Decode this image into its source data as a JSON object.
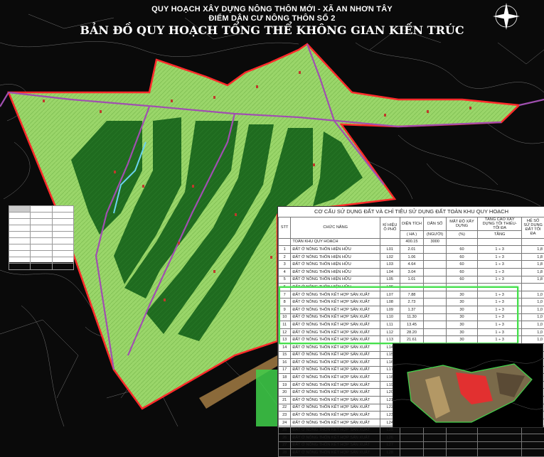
{
  "header": {
    "line1": "QUY HOẠCH XÂY DỰNG NÔNG THÔN MỚI - XÃ AN NHƠN TÂY",
    "line2": "ĐIỂM DÂN CƯ NÔNG THÔN SỐ 2",
    "title": "BẢN ĐỒ QUY HOẠCH TỔNG THỂ KHÔNG GIAN KIẾN TRÚC"
  },
  "colors": {
    "background": "#0a0a0a",
    "light_green": "#9ad66a",
    "dark_green": "#1f6b1f",
    "boundary_red": "#ff2a2a",
    "road_purple": "#a04fb0",
    "highlight": "#43e04a"
  },
  "icons": {
    "compass": "north-arrow-icon"
  },
  "table": {
    "caption": "CƠ CẤU SỬ DỤNG ĐẤT VÀ CHỈ TIÊU SỬ DỤNG ĐẤT TOÀN KHU QUY HOẠCH",
    "headers": {
      "stt": "STT",
      "name": "CHỨC NĂNG",
      "kh": "KÍ HIỆU Ô PHỐ",
      "dt": "DIỆN TÍCH",
      "dt_unit": "( HA )",
      "ds": "DÂN SỐ",
      "ds_unit": "(NGƯỜI)",
      "md": "MẬT ĐỘ XÂY DỰNG",
      "md_unit": "(%)",
      "tc": "TẦNG CAO XÂY DỰNG TỐI THIỂU-TỐI ĐA",
      "tc_unit": "TẦNG",
      "hs": "HỆ SỐ SỬ DỤNG ĐẤT TỐI ĐA"
    },
    "total": {
      "name": "TOÀN KHU QUY HOẠCH",
      "dt": "400.15",
      "ds": "3000"
    },
    "rows": [
      {
        "stt": "1",
        "name": "ĐẤT Ở NÔNG THÔN HIỆN HỮU",
        "kh": "L01",
        "dt": "2.01",
        "md": "60",
        "tc": "1 ÷ 3",
        "hs": "1,8"
      },
      {
        "stt": "2",
        "name": "ĐẤT Ở NÔNG THÔN HIỆN HỮU",
        "kh": "L02",
        "dt": "1.06",
        "md": "60",
        "tc": "1 ÷ 3",
        "hs": "1,8"
      },
      {
        "stt": "3",
        "name": "ĐẤT Ở NÔNG THÔN HIỆN HỮU",
        "kh": "L03",
        "dt": "4.64",
        "md": "60",
        "tc": "1 ÷ 3",
        "hs": "1,8"
      },
      {
        "stt": "4",
        "name": "ĐẤT Ở NÔNG THÔN HIỆN HỮU",
        "kh": "L04",
        "dt": "3.04",
        "md": "60",
        "tc": "1 ÷ 3",
        "hs": "1,8"
      },
      {
        "stt": "5",
        "name": "ĐẤT Ở NÔNG THÔN HIỆN HỮU",
        "kh": "L05",
        "dt": "1.01",
        "md": "60",
        "tc": "1 ÷ 3",
        "hs": "1,8"
      },
      {
        "stt": "6",
        "name": "ĐẤT Ở NÔNG THÔN HIỆN HỮU",
        "kh": "L06",
        "dt": "",
        "md": "",
        "tc": "",
        "hs": ""
      },
      {
        "stt": "7",
        "name": "ĐẤT Ở NÔNG THÔN KẾT HỢP SẢN XUẤT",
        "kh": "L07",
        "dt": "7.88",
        "md": "30",
        "tc": "1 ÷ 3",
        "hs": "1,0"
      },
      {
        "stt": "8",
        "name": "ĐẤT Ở NÔNG THÔN KẾT HỢP SẢN XUẤT",
        "kh": "L08",
        "dt": "2.73",
        "md": "30",
        "tc": "1 ÷ 3",
        "hs": "1,0"
      },
      {
        "stt": "9",
        "name": "ĐẤT Ở NÔNG THÔN KẾT HỢP SẢN XUẤT",
        "kh": "L09",
        "dt": "1.37",
        "md": "30",
        "tc": "1 ÷ 3",
        "hs": "1,0"
      },
      {
        "stt": "10",
        "name": "ĐẤT Ở NÔNG THÔN KẾT HỢP SẢN XUẤT",
        "kh": "L10",
        "dt": "11.30",
        "md": "30",
        "tc": "1 ÷ 3",
        "hs": "1,0"
      },
      {
        "stt": "11",
        "name": "ĐẤT Ở NÔNG THÔN KẾT HỢP SẢN XUẤT",
        "kh": "L11",
        "dt": "13.45",
        "md": "30",
        "tc": "1 ÷ 3",
        "hs": "1,0"
      },
      {
        "stt": "12",
        "name": "ĐẤT Ở NÔNG THÔN KẾT HỢP SẢN XUẤT",
        "kh": "L12",
        "dt": "28.20",
        "md": "30",
        "tc": "1 ÷ 3",
        "hs": "1,0"
      },
      {
        "stt": "13",
        "name": "ĐẤT Ở NÔNG THÔN KẾT HỢP SẢN XUẤT",
        "kh": "L13",
        "dt": "21.61",
        "md": "30",
        "tc": "1 ÷ 3",
        "hs": "1,0"
      },
      {
        "stt": "14",
        "name": "ĐẤT Ở NÔNG THÔN KẾT HỢP SẢN XUẤT",
        "kh": "L14",
        "dt": "",
        "md": "",
        "tc": "",
        "hs": "1,0"
      },
      {
        "stt": "15",
        "name": "ĐẤT Ở NÔNG THÔN KẾT HỢP SẢN XUẤT",
        "kh": "L15",
        "dt": "",
        "md": "",
        "tc": "",
        "hs": ""
      },
      {
        "stt": "16",
        "name": "ĐẤT Ở NÔNG THÔN KẾT HỢP SẢN XUẤT",
        "kh": "L16",
        "dt": "",
        "md": "",
        "tc": "",
        "hs": ""
      },
      {
        "stt": "17",
        "name": "ĐẤT Ở NÔNG THÔN KẾT HỢP SẢN XUẤT",
        "kh": "L17",
        "dt": "",
        "md": "",
        "tc": "",
        "hs": ""
      },
      {
        "stt": "18",
        "name": "ĐẤT Ở NÔNG THÔN KẾT HỢP SẢN XUẤT",
        "kh": "L18",
        "dt": "",
        "md": "",
        "tc": "",
        "hs": ""
      },
      {
        "stt": "19",
        "name": "ĐẤT Ở NÔNG THÔN KẾT HỢP SẢN XUẤT",
        "kh": "L19",
        "dt": "",
        "md": "",
        "tc": "",
        "hs": ""
      },
      {
        "stt": "20",
        "name": "ĐẤT Ở NÔNG THÔN KẾT HỢP SẢN XUẤT",
        "kh": "L20",
        "dt": "",
        "md": "",
        "tc": "",
        "hs": ""
      },
      {
        "stt": "21",
        "name": "ĐẤT Ở NÔNG THÔN KẾT HỢP SẢN XUẤT",
        "kh": "L21",
        "dt": "",
        "md": "",
        "tc": "",
        "hs": ""
      },
      {
        "stt": "22",
        "name": "ĐẤT Ở NÔNG THÔN KẾT HỢP SẢN XUẤT",
        "kh": "L22",
        "dt": "",
        "md": "",
        "tc": "",
        "hs": ""
      },
      {
        "stt": "23",
        "name": "ĐẤT Ở NÔNG THÔN KẾT HỢP SẢN XUẤT",
        "kh": "L23",
        "dt": "",
        "md": "",
        "tc": "",
        "hs": ""
      },
      {
        "stt": "24",
        "name": "ĐẤT Ở NÔNG THÔN KẾT HỢP SẢN XUẤT",
        "kh": "L24",
        "dt": "",
        "md": "",
        "tc": "",
        "hs": ""
      },
      {
        "stt": "25",
        "name": "ĐẤT Ở NÔNG THÔN KẾT HỢP SẢN XUẤT",
        "kh": "L25",
        "dt": "",
        "md": "",
        "tc": "",
        "hs": ""
      },
      {
        "stt": "26",
        "name": "ĐẤT Ở NÔNG THÔN KẾT HỢP SẢN XUẤT",
        "kh": "L26",
        "dt": "",
        "md": "",
        "tc": "",
        "hs": ""
      },
      {
        "stt": "27",
        "name": "ĐẤT Ở NÔNG THÔN KẾT HỢP SẢN XUẤT",
        "kh": "L27",
        "dt": "",
        "md": "",
        "tc": "",
        "hs": ""
      },
      {
        "stt": "28",
        "name": "ĐẤT Ở NÔNG THÔN KẾT HỢP SẢN XUẤT",
        "kh": "L28",
        "dt": "",
        "md": "",
        "tc": "",
        "hs": ""
      }
    ]
  }
}
